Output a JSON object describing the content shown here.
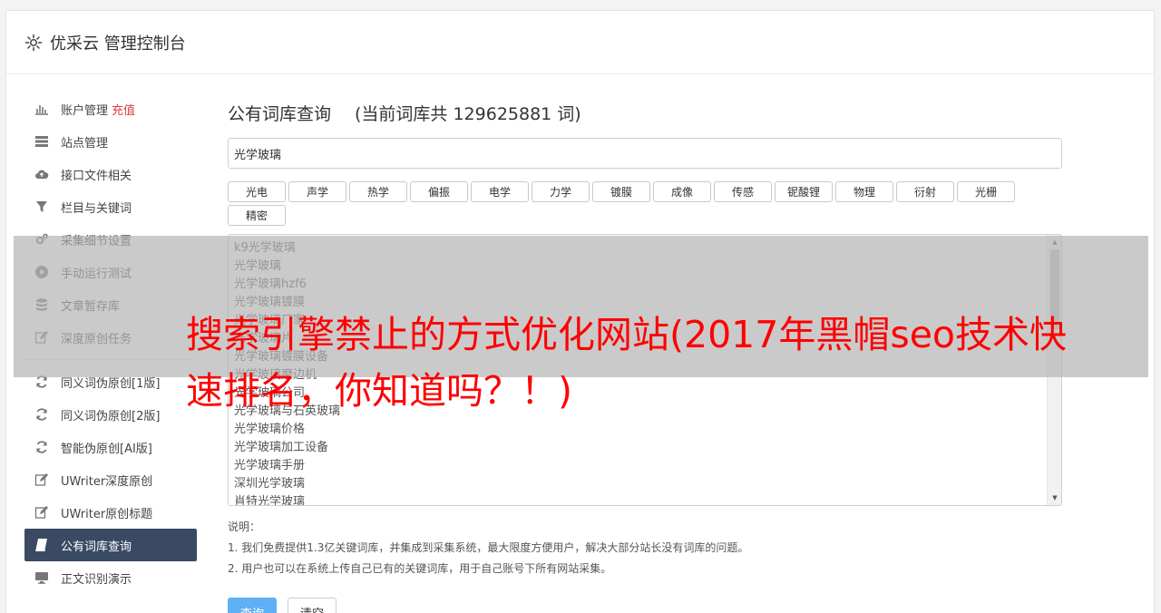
{
  "header": {
    "title": "优采云 管理控制台"
  },
  "sidebar": {
    "items": [
      {
        "label": "账户管理",
        "tag": "充值",
        "icon": "bar-chart-icon"
      },
      {
        "label": "站点管理",
        "icon": "server-icon"
      },
      {
        "label": "接口文件相关",
        "icon": "cloud-upload-icon"
      },
      {
        "label": "栏目与关键词",
        "icon": "filter-icon"
      },
      {
        "label": "采集细节设置",
        "icon": "cogs-icon"
      },
      {
        "label": "手动运行测试",
        "icon": "play-circle-icon"
      },
      {
        "label": "文章暂存库",
        "icon": "database-icon"
      },
      {
        "label": "深度原创任务",
        "icon": "edit-icon"
      }
    ],
    "items2": [
      {
        "label": "同义词伪原创[1版]",
        "icon": "refresh-icon"
      },
      {
        "label": "同义词伪原创[2版]",
        "icon": "refresh-icon"
      },
      {
        "label": "智能伪原创[AI版]",
        "icon": "refresh-icon"
      },
      {
        "label": "UWriter深度原创",
        "icon": "edit-icon"
      },
      {
        "label": "UWriter原创标题",
        "icon": "edit-icon"
      },
      {
        "label": "公有词库查询",
        "icon": "book-icon",
        "active": true
      },
      {
        "label": "正文识别演示",
        "icon": "desktop-icon"
      }
    ]
  },
  "main": {
    "title": "公有词库查询",
    "count_text": "(当前词库共 129625881 词)",
    "search_value": "光学玻璃",
    "tags": [
      "光电",
      "声学",
      "热学",
      "偏振",
      "电学",
      "力学",
      "镀膜",
      "成像",
      "传感",
      "铌酸锂",
      "物理",
      "衍射",
      "光栅",
      "精密"
    ],
    "results": [
      "k9光学玻璃",
      "光学玻璃",
      "光学玻璃hzf6",
      "光学玻璃镀膜",
      "光学玻璃厂家",
      "光学玻璃片",
      "光学玻璃镀膜设备",
      "光学玻璃磨边机",
      "光学玻璃公司",
      "光学玻璃与石英玻璃",
      "光学玻璃价格",
      "光学玻璃加工设备",
      "光学玻璃手册",
      "深圳光学玻璃",
      "肖特光学玻璃"
    ],
    "notes_title": "说明：",
    "notes": [
      "1. 我们免费提供1.3亿关键词库，并集成到采集系统，最大限度方便用户，解决大部分站长没有词库的问题。",
      "2. 用户也可以在系统上传自己已有的关键词库，用于自己账号下所有网站采集。"
    ],
    "query_button": "查询",
    "clear_button": "清空"
  },
  "overlay": {
    "headline": "搜索引擎禁止的方式优化网站(2017年黑帽seo技术快速排名，你知道吗？！)"
  },
  "colors": {
    "accent": "#5cb0f3",
    "active_nav": "#3a4a63",
    "headline": "#ff0000",
    "tag": "#e23b3b"
  }
}
